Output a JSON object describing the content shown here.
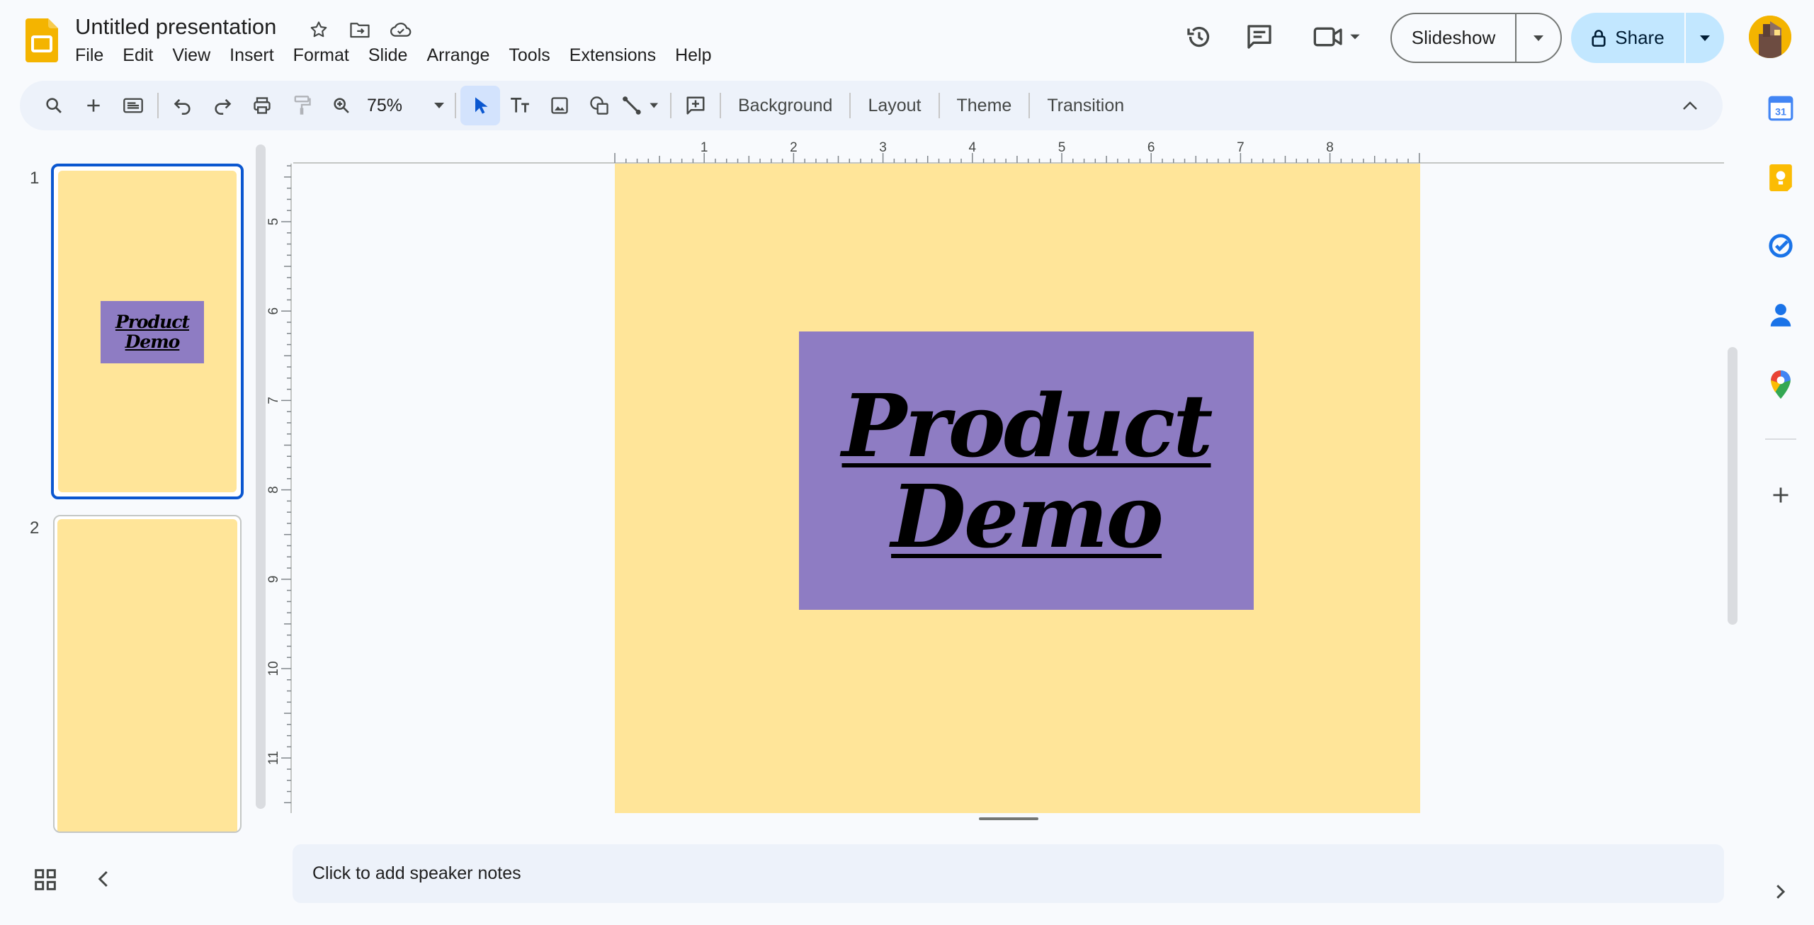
{
  "app": {
    "title": "Untitled presentation",
    "menu": [
      "File",
      "Edit",
      "View",
      "Insert",
      "Format",
      "Slide",
      "Arrange",
      "Tools",
      "Extensions",
      "Help"
    ]
  },
  "header": {
    "slideshow_label": "Slideshow",
    "share_label": "Share"
  },
  "toolbar": {
    "zoom": "75%",
    "background_label": "Background",
    "layout_label": "Layout",
    "theme_label": "Theme",
    "transition_label": "Transition"
  },
  "rulers": {
    "horizontal_labels": [
      "1",
      "2",
      "3",
      "4",
      "5",
      "6",
      "7",
      "8"
    ],
    "vertical_labels": [
      "5",
      "6",
      "7",
      "8",
      "9",
      "10",
      "11"
    ]
  },
  "filmstrip": {
    "slides": [
      {
        "number": "1",
        "title": "Product Demo",
        "selected": true
      },
      {
        "number": "2",
        "title": "",
        "selected": false
      }
    ]
  },
  "slide": {
    "title_line1": "Product",
    "title_line2": "Demo",
    "background_color": "#ffe599",
    "title_box_color": "#8e7cc3"
  },
  "notes": {
    "placeholder": "Click to add speaker notes"
  },
  "side_panel": {
    "icons": [
      "calendar-icon",
      "keep-icon",
      "tasks-icon",
      "contacts-icon",
      "maps-icon",
      "add-icon"
    ],
    "calendar_day": "31"
  },
  "colors": {
    "accent": "#0b57d0",
    "share_bg": "#c2e7ff",
    "toolbar_bg": "#edf2fa"
  }
}
